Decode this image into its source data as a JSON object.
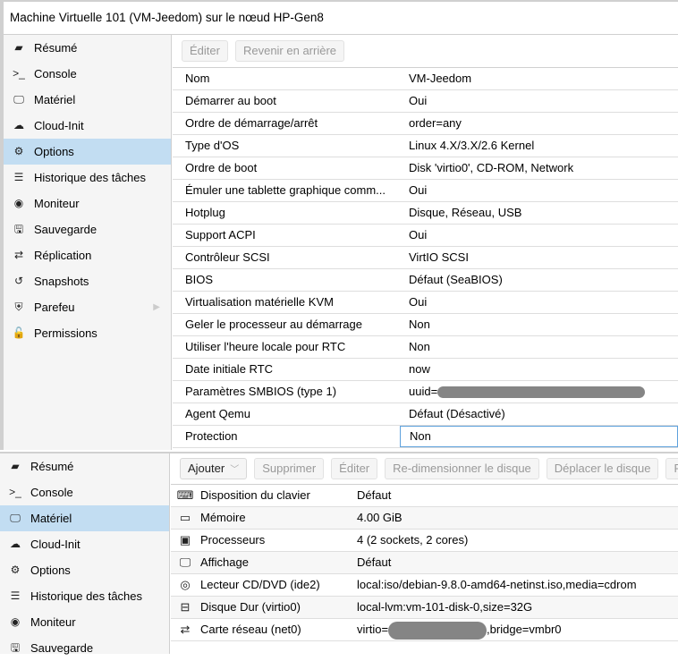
{
  "top": {
    "title": "Machine Virtuelle 101 (VM-Jeedom) sur le nœud HP-Gen8",
    "nav": [
      {
        "icon": "book-icon",
        "glyph": "▰",
        "label": "Résumé",
        "active": false
      },
      {
        "icon": "terminal-icon",
        "glyph": ">_",
        "label": "Console",
        "active": false
      },
      {
        "icon": "monitor-icon",
        "glyph": "🖵",
        "label": "Matériel",
        "active": false
      },
      {
        "icon": "cloud-icon",
        "glyph": "☁",
        "label": "Cloud-Init",
        "active": false
      },
      {
        "icon": "gear-icon",
        "glyph": "⚙",
        "label": "Options",
        "active": true
      },
      {
        "icon": "list-icon",
        "glyph": "☰",
        "label": "Historique des tâches",
        "active": false
      },
      {
        "icon": "eye-icon",
        "glyph": "◉",
        "label": "Moniteur",
        "active": false
      },
      {
        "icon": "floppy-icon",
        "glyph": "🖫",
        "label": "Sauvegarde",
        "active": false
      },
      {
        "icon": "retweet-icon",
        "glyph": "⇄",
        "label": "Réplication",
        "active": false
      },
      {
        "icon": "history-icon",
        "glyph": "↺",
        "label": "Snapshots",
        "active": false
      },
      {
        "icon": "shield-icon",
        "glyph": "⛨",
        "label": "Parefeu",
        "active": false,
        "has_submenu": true
      },
      {
        "icon": "unlock-icon",
        "glyph": "🔓",
        "label": "Permissions",
        "active": false
      }
    ],
    "toolbar": {
      "edit_label": "Éditer",
      "revert_label": "Revenir en arrière"
    },
    "options": [
      {
        "key": "Nom",
        "value": "VM-Jeedom"
      },
      {
        "key": "Démarrer au boot",
        "value": "Oui"
      },
      {
        "key": "Ordre de démarrage/arrêt",
        "value": "order=any"
      },
      {
        "key": "Type d'OS",
        "value": "Linux 4.X/3.X/2.6 Kernel"
      },
      {
        "key": "Ordre de boot",
        "value": "Disk 'virtio0', CD-ROM, Network"
      },
      {
        "key": "Émuler une tablette graphique comm...",
        "value": "Oui"
      },
      {
        "key": "Hotplug",
        "value": "Disque, Réseau, USB"
      },
      {
        "key": "Support ACPI",
        "value": "Oui"
      },
      {
        "key": "Contrôleur SCSI",
        "value": "VirtIO SCSI"
      },
      {
        "key": "BIOS",
        "value": "Défaut (SeaBIOS)"
      },
      {
        "key": "Virtualisation matérielle KVM",
        "value": "Oui"
      },
      {
        "key": "Geler le processeur au démarrage",
        "value": "Non"
      },
      {
        "key": "Utiliser l'heure locale pour RTC",
        "value": "Non"
      },
      {
        "key": "Date initiale RTC",
        "value": "now"
      },
      {
        "key": "Paramètres SMBIOS (type 1)",
        "value": "uuid=",
        "redacted": true
      },
      {
        "key": "Agent Qemu",
        "value": "Défaut (Désactivé)"
      },
      {
        "key": "Protection",
        "value": "Non",
        "selected": true
      }
    ]
  },
  "bottom": {
    "nav": [
      {
        "icon": "book-icon",
        "glyph": "▰",
        "label": "Résumé",
        "active": false
      },
      {
        "icon": "terminal-icon",
        "glyph": ">_",
        "label": "Console",
        "active": false
      },
      {
        "icon": "monitor-icon",
        "glyph": "🖵",
        "label": "Matériel",
        "active": true
      },
      {
        "icon": "cloud-icon",
        "glyph": "☁",
        "label": "Cloud-Init",
        "active": false
      },
      {
        "icon": "gear-icon",
        "glyph": "⚙",
        "label": "Options",
        "active": false
      },
      {
        "icon": "list-icon",
        "glyph": "☰",
        "label": "Historique des tâches",
        "active": false
      },
      {
        "icon": "eye-icon",
        "glyph": "◉",
        "label": "Moniteur",
        "active": false
      },
      {
        "icon": "floppy-icon",
        "glyph": "🖫",
        "label": "Sauvegarde",
        "active": false
      }
    ],
    "toolbar": {
      "add_label": "Ajouter",
      "delete_label": "Supprimer",
      "edit_label": "Éditer",
      "resize_label": "Re-dimensionner le disque",
      "move_label": "Déplacer le disque",
      "revert_label": "Revenir en arrière"
    },
    "hardware": [
      {
        "icon": "keyboard-icon",
        "glyph": "⌨",
        "key": "Disposition du clavier",
        "value": "Défaut"
      },
      {
        "icon": "memory-icon",
        "glyph": "▭",
        "key": "Mémoire",
        "value": "4.00 GiB"
      },
      {
        "icon": "cpu-icon",
        "glyph": "▣",
        "key": "Processeurs",
        "value": "4 (2 sockets, 2 cores)"
      },
      {
        "icon": "display-icon",
        "glyph": "🖵",
        "key": "Affichage",
        "value": "Défaut"
      },
      {
        "icon": "cdrom-icon",
        "glyph": "◎",
        "key": "Lecteur CD/DVD (ide2)",
        "value": "local:iso/debian-9.8.0-amd64-netinst.iso,media=cdrom"
      },
      {
        "icon": "harddisk-icon",
        "glyph": "⊟",
        "key": "Disque Dur (virtio0)",
        "value": "local-lvm:vm-101-disk-0,size=32G"
      },
      {
        "icon": "network-icon",
        "glyph": "⇄",
        "key": "Carte réseau (net0)",
        "value": "virtio=",
        "value_suffix": ",bridge=vmbr0",
        "redacted": true
      }
    ]
  }
}
